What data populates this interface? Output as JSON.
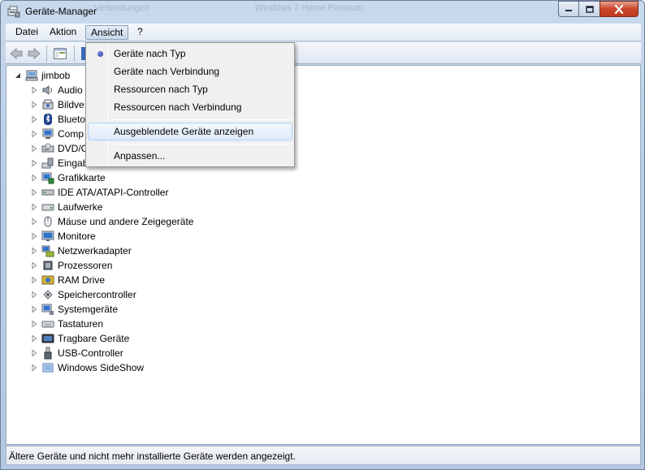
{
  "window": {
    "title": "Geräte-Manager",
    "ghost_titles": [
      "Verbindungen",
      "Windows 7 Home Premium"
    ]
  },
  "menubar": {
    "items": [
      "Datei",
      "Aktion",
      "Ansicht",
      "?"
    ],
    "active": "Ansicht"
  },
  "dropdown": {
    "items": [
      {
        "label": "Geräte nach Typ",
        "selected": true
      },
      {
        "label": "Geräte nach Verbindung"
      },
      {
        "label": "Ressourcen nach Typ"
      },
      {
        "label": "Ressourcen nach Verbindung"
      },
      {
        "label": "Ausgeblendete Geräte anzeigen",
        "highlighted": true
      },
      {
        "label": "Anpassen..."
      }
    ]
  },
  "tree": {
    "root": "jimbob",
    "children": [
      {
        "label": "Audio",
        "icon": "speaker-icon"
      },
      {
        "label": "Bildve",
        "icon": "imaging-device-icon"
      },
      {
        "label": "Blueto",
        "icon": "bluetooth-icon"
      },
      {
        "label": "Comp",
        "icon": "computer-icon"
      },
      {
        "label": "DVD/C",
        "icon": "dvd-drive-icon"
      },
      {
        "label": "Eingab",
        "icon": "input-device-icon"
      },
      {
        "label": "Grafikkarte",
        "icon": "display-adapter-icon"
      },
      {
        "label": "IDE ATA/ATAPI-Controller",
        "icon": "ide-controller-icon"
      },
      {
        "label": "Laufwerke",
        "icon": "disk-drive-icon"
      },
      {
        "label": "Mäuse und andere Zeigegeräte",
        "icon": "mouse-icon"
      },
      {
        "label": "Monitore",
        "icon": "monitor-icon"
      },
      {
        "label": "Netzwerkadapter",
        "icon": "network-adapter-icon"
      },
      {
        "label": "Prozessoren",
        "icon": "processor-icon"
      },
      {
        "label": "RAM Drive",
        "icon": "ram-drive-icon"
      },
      {
        "label": "Speichercontroller",
        "icon": "storage-controller-icon"
      },
      {
        "label": "Systemgeräte",
        "icon": "system-devices-icon"
      },
      {
        "label": "Tastaturen",
        "icon": "keyboard-icon"
      },
      {
        "label": "Tragbare Geräte",
        "icon": "portable-device-icon"
      },
      {
        "label": "USB-Controller",
        "icon": "usb-icon"
      },
      {
        "label": "Windows SideShow",
        "icon": "sideshow-icon"
      }
    ]
  },
  "status": {
    "text": "Ältere Geräte und nicht mehr installierte Geräte werden angezeigt."
  },
  "colors": {
    "accent": "#2a3aa8",
    "close_button": "#c8462b",
    "highlight_border": "#aecff7"
  }
}
